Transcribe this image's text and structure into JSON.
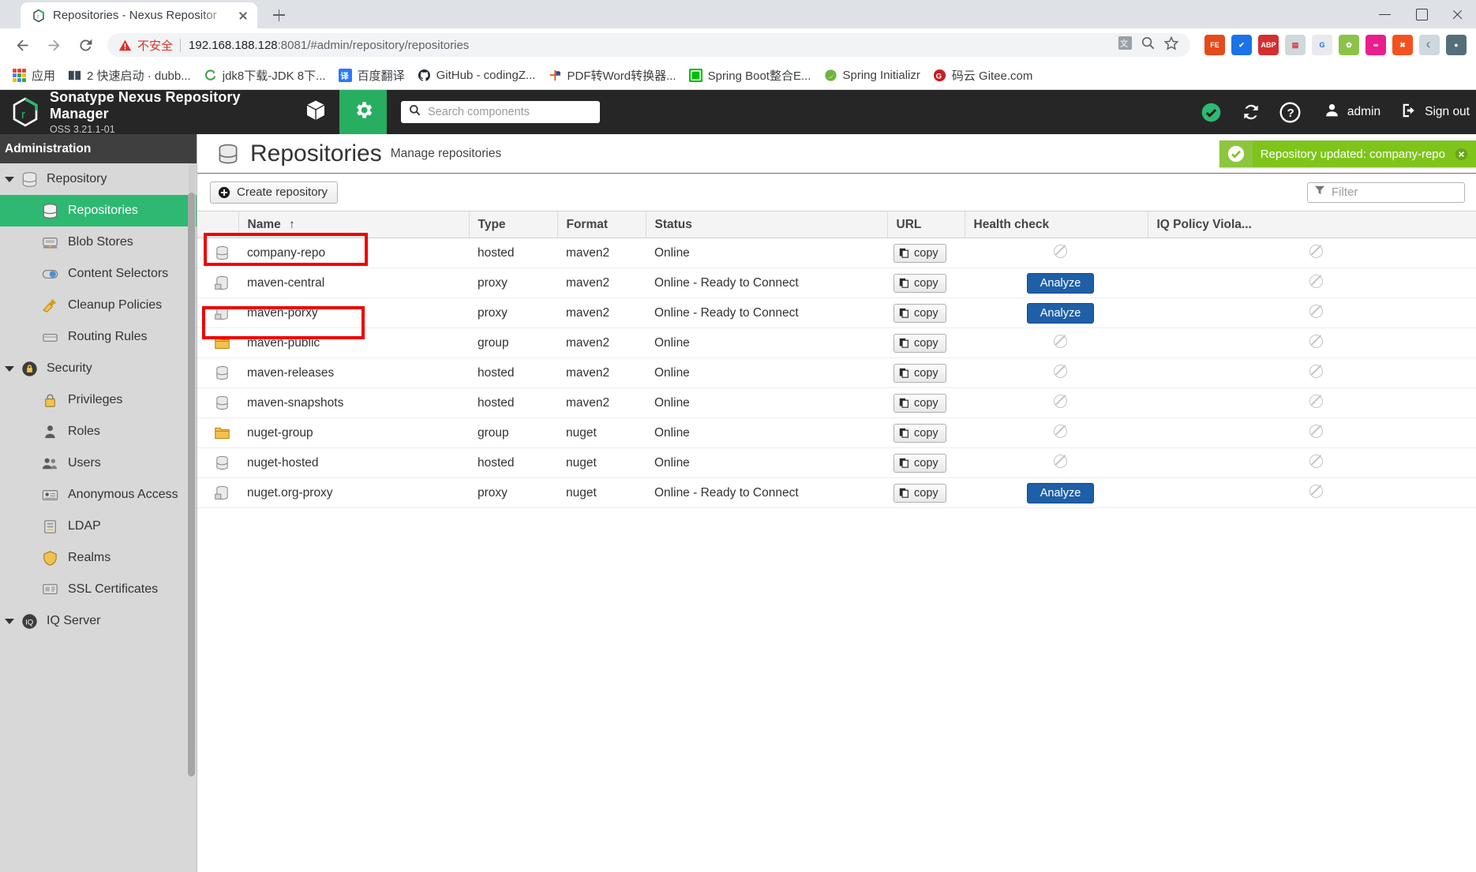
{
  "browser": {
    "tab": {
      "title": "Repositories - Nexus Repositor",
      "favicon_name": "nexus-favicon"
    },
    "newtab_label": "+",
    "window_controls": [
      "minimize",
      "maximize",
      "close"
    ],
    "address": {
      "insecure_label": "不安全",
      "url_host": "192.168.188.128",
      "url_port": ":8081",
      "url_path": "/#admin/repository/repositories",
      "full_url": "192.168.188.128:8081/#admin/repository/repositories"
    },
    "nav": {
      "back": "back",
      "forward": "forward",
      "reload": "reload"
    },
    "omni_icons": [
      "translate-icon",
      "zoom-icon",
      "bookmark-star-icon"
    ],
    "extensions": [
      "fe-helper",
      "checkmark-ext",
      "abp",
      "red-ext",
      "google-translate-ext",
      "colorful-ext",
      "infinity-ext",
      "orange-x-ext",
      "moon-ext",
      "profile-ext"
    ],
    "bookmarks": [
      {
        "label": "应用",
        "icon": "apps-grid-icon"
      },
      {
        "label": "2 快速启动 · dubb...",
        "icon": "book-icon"
      },
      {
        "label": "jdk8下载-JDK 8下...",
        "icon": "green-c-icon"
      },
      {
        "label": "百度翻译",
        "icon": "translate-icon"
      },
      {
        "label": "GitHub - codingZ...",
        "icon": "github-icon"
      },
      {
        "label": "PDF转Word转换器...",
        "icon": "pdf-icon"
      },
      {
        "label": "Spring Boot整合E...",
        "icon": "iqiyi-icon"
      },
      {
        "label": "Spring Initializr",
        "icon": "spring-leaf-icon"
      },
      {
        "label": "码云 Gitee.com",
        "icon": "gitee-icon"
      }
    ]
  },
  "nexus": {
    "brand": {
      "title": "Sonatype Nexus Repository Manager",
      "subtitle": "OSS 3.21.1-01",
      "logo_name": "nexus-logo"
    },
    "header": {
      "browse_icon": "cube-icon",
      "admin_icon": "gear-icon",
      "search_placeholder": "Search components",
      "search_icon": "search-icon",
      "status_icon": "health-check-icon",
      "refresh_icon": "refresh-icon",
      "help_icon": "help-icon",
      "user_icon": "user-icon",
      "user_label": "admin",
      "signout_icon": "signout-icon",
      "signout_label": "Sign out"
    },
    "sidebar": {
      "heading": "Administration",
      "groups": [
        {
          "label": "Repository",
          "icon": "database-icon",
          "expanded": true,
          "items": [
            {
              "label": "Repositories",
              "icon": "database-icon",
              "selected": true
            },
            {
              "label": "Blob Stores",
              "icon": "blobstore-icon",
              "selected": false
            },
            {
              "label": "Content Selectors",
              "icon": "toggle-icon",
              "selected": false
            },
            {
              "label": "Cleanup Policies",
              "icon": "broom-icon",
              "selected": false
            },
            {
              "label": "Routing Rules",
              "icon": "route-icon",
              "selected": false
            }
          ]
        },
        {
          "label": "Security",
          "icon": "shield-icon",
          "expanded": true,
          "items": [
            {
              "label": "Privileges",
              "icon": "privileges-icon",
              "selected": false
            },
            {
              "label": "Roles",
              "icon": "roles-icon",
              "selected": false
            },
            {
              "label": "Users",
              "icon": "users-icon",
              "selected": false
            },
            {
              "label": "Anonymous Access",
              "icon": "anonymous-icon",
              "selected": false
            },
            {
              "label": "LDAP",
              "icon": "ldap-icon",
              "selected": false
            },
            {
              "label": "Realms",
              "icon": "realms-icon",
              "selected": false
            },
            {
              "label": "SSL Certificates",
              "icon": "certificate-icon",
              "selected": false
            }
          ]
        },
        {
          "label": "IQ Server",
          "icon": "iq-server-icon",
          "expanded": false,
          "items": []
        }
      ]
    },
    "page": {
      "icon": "database-icon",
      "title": "Repositories",
      "subtitle": "Manage repositories",
      "toast": {
        "message": "Repository updated: company-repo",
        "icon": "success-check-icon",
        "close_icon": "close-icon",
        "color": "#7fc41b"
      }
    },
    "toolbar": {
      "create_label": "Create repository",
      "create_icon": "plus-circle-icon",
      "filter_placeholder": "Filter",
      "filter_icon": "funnel-icon",
      "filter_value": ""
    },
    "table": {
      "columns": [
        "Name",
        "Type",
        "Format",
        "Status",
        "URL",
        "Health check",
        "IQ Policy Viola..."
      ],
      "sort_column": "Name",
      "sort_direction": "asc",
      "copy_label": "copy",
      "analyze_label": "Analyze",
      "rows": [
        {
          "icon": "hosted-repo-icon",
          "name": "company-repo",
          "type": "hosted",
          "format": "maven2",
          "status": "Online",
          "url": "copy",
          "health": "none",
          "iq": "none",
          "highlighted": true
        },
        {
          "icon": "proxy-repo-icon",
          "name": "maven-central",
          "type": "proxy",
          "format": "maven2",
          "status": "Online - Ready to Connect",
          "url": "copy",
          "health": "analyze",
          "iq": "none",
          "highlighted": false
        },
        {
          "icon": "proxy-repo-icon",
          "name": "maven-porxy",
          "type": "proxy",
          "format": "maven2",
          "status": "Online - Ready to Connect",
          "url": "copy",
          "health": "analyze",
          "iq": "none",
          "highlighted": true
        },
        {
          "icon": "group-repo-icon",
          "name": "maven-public",
          "type": "group",
          "format": "maven2",
          "status": "Online",
          "url": "copy",
          "health": "none",
          "iq": "none",
          "highlighted": false
        },
        {
          "icon": "hosted-repo-icon",
          "name": "maven-releases",
          "type": "hosted",
          "format": "maven2",
          "status": "Online",
          "url": "copy",
          "health": "none",
          "iq": "none",
          "highlighted": false
        },
        {
          "icon": "hosted-repo-icon",
          "name": "maven-snapshots",
          "type": "hosted",
          "format": "maven2",
          "status": "Online",
          "url": "copy",
          "health": "none",
          "iq": "none",
          "highlighted": false
        },
        {
          "icon": "group-repo-icon",
          "name": "nuget-group",
          "type": "group",
          "format": "nuget",
          "status": "Online",
          "url": "copy",
          "health": "none",
          "iq": "none",
          "highlighted": false
        },
        {
          "icon": "hosted-repo-icon",
          "name": "nuget-hosted",
          "type": "hosted",
          "format": "nuget",
          "status": "Online",
          "url": "copy",
          "health": "none",
          "iq": "none",
          "highlighted": false
        },
        {
          "icon": "proxy-repo-icon",
          "name": "nuget.org-proxy",
          "type": "proxy",
          "format": "nuget",
          "status": "Online - Ready to Connect",
          "url": "copy",
          "health": "analyze",
          "iq": "none",
          "highlighted": false
        }
      ]
    }
  }
}
